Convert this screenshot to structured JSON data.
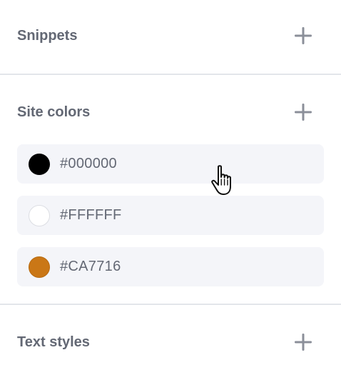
{
  "sections": {
    "snippets": {
      "title": "Snippets",
      "add_icon": "plus-icon"
    },
    "site_colors": {
      "title": "Site colors",
      "add_icon": "plus-icon",
      "colors": [
        {
          "value": "#000000",
          "swatch": "#000000"
        },
        {
          "value": "#FFFFFF",
          "swatch": "#FFFFFF"
        },
        {
          "value": "#CA7716",
          "swatch": "#CA7716"
        }
      ]
    },
    "text_styles": {
      "title": "Text styles",
      "add_icon": "plus-icon"
    }
  },
  "cursor": {
    "icon": "hand-pointer-icon"
  },
  "colors": {
    "text": "#636874",
    "row_bg": "#F4F5F9",
    "divider": "#E3E5EA",
    "icon": "#8B8F99"
  }
}
